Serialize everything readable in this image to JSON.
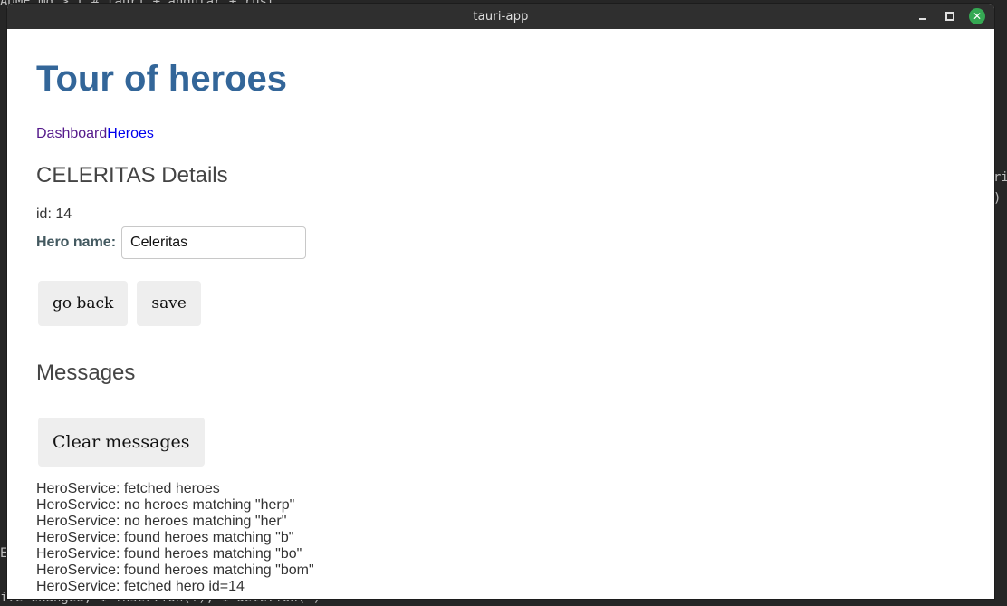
{
  "window": {
    "title": "tauri-app"
  },
  "background": {
    "top_fragment": "ADME.md > [ # tauri + angular + rust",
    "right_fragment_1": "ri",
    "right_fragment_2": ")",
    "left_fragment": "E",
    "bottom_fragment": "ite changed, 1 insertion(+), 1 deletion(-)"
  },
  "app": {
    "title": "Tour of heroes",
    "nav": {
      "dashboard_label": "Dashboard",
      "heroes_label": "Heroes"
    },
    "hero_detail": {
      "heading": "CELERITAS Details",
      "id_label": "id: 14",
      "name_label": "Hero name:",
      "name_value": "Celeritas",
      "go_back_label": "go back",
      "save_label": "save"
    },
    "messages": {
      "heading": "Messages",
      "clear_label": "Clear messages",
      "items": [
        "HeroService: fetched heroes",
        "HeroService: no heroes matching \"herp\"",
        "HeroService: no heroes matching \"her\"",
        "HeroService: found heroes matching \"b\"",
        "HeroService: found heroes matching \"bo\"",
        "HeroService: found heroes matching \"bom\"",
        "HeroService: fetched hero id=14"
      ]
    }
  },
  "icons": {
    "minimize": "minimize-icon",
    "maximize": "maximize-icon",
    "close": "close-icon"
  },
  "colors": {
    "title_blue": "#336699",
    "close_green": "#35a853",
    "titlebar": "#2f2f2f",
    "button_bg": "#eeeeee"
  }
}
